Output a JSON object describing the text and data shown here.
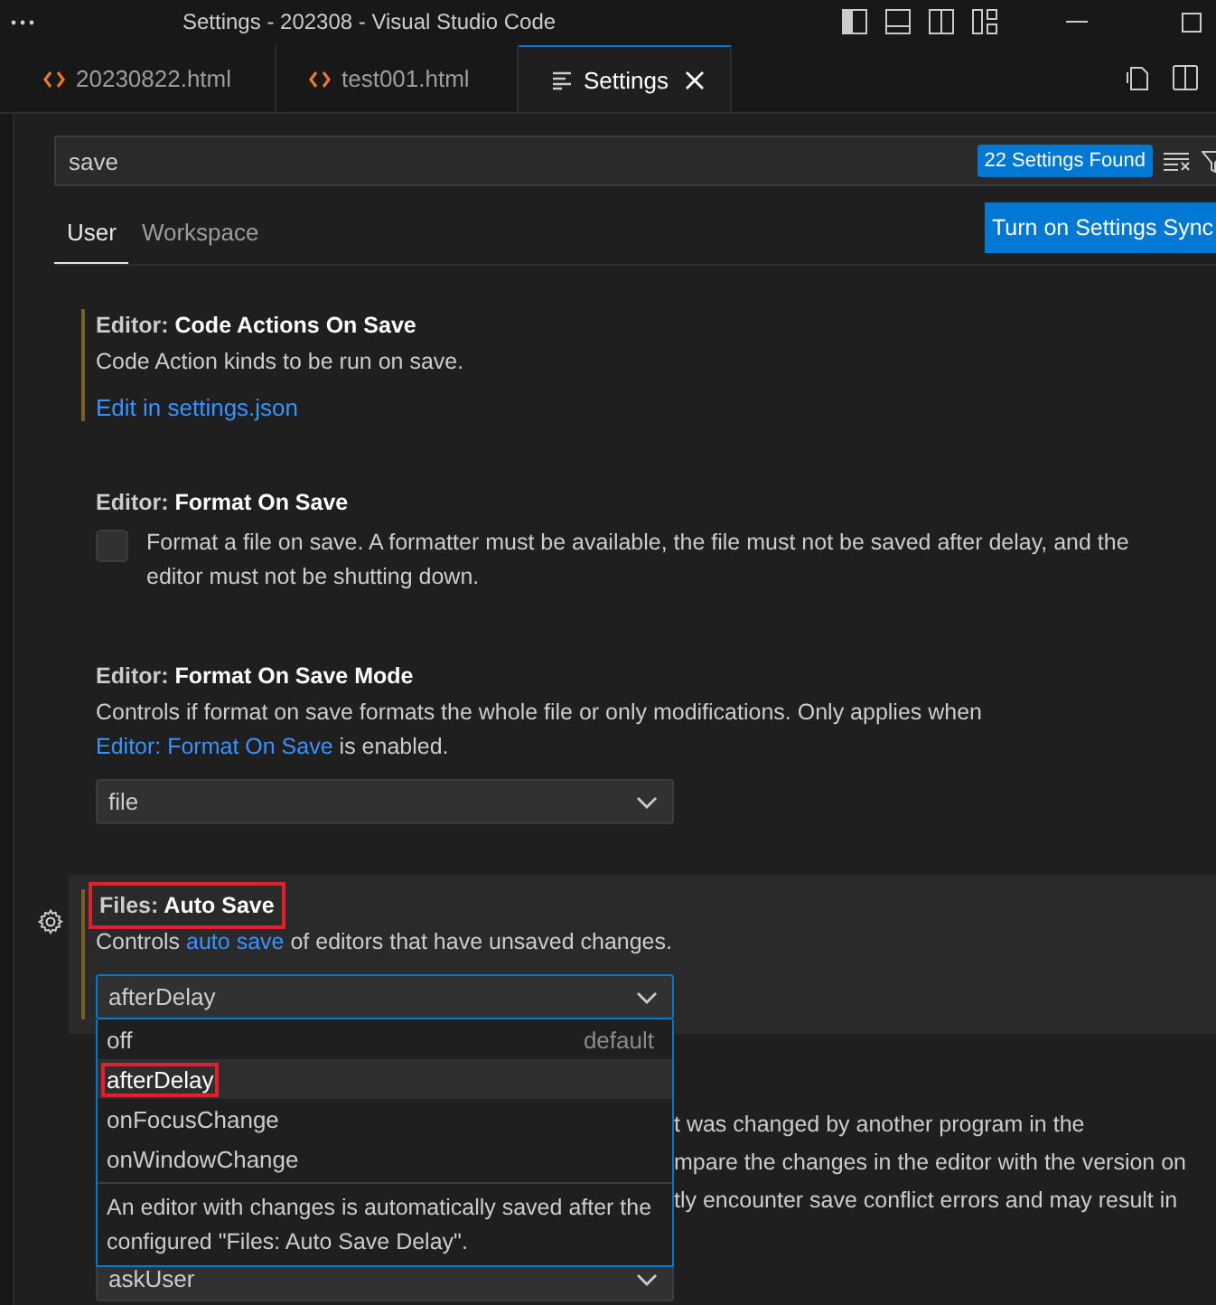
{
  "window": {
    "title": "Settings - 202308 - Visual Studio Code"
  },
  "tabs": [
    {
      "label": "20230822.html",
      "kind": "html",
      "selected": false
    },
    {
      "label": "test001.html",
      "kind": "html",
      "selected": false
    },
    {
      "label": "Settings",
      "kind": "settings",
      "selected": true
    }
  ],
  "search": {
    "value": "save",
    "result_count": "22 Settings Found"
  },
  "scope_tabs": [
    {
      "label": "User",
      "selected": true
    },
    {
      "label": "Workspace",
      "selected": false
    }
  ],
  "sync_button": "Turn on Settings Sync",
  "settings": [
    {
      "kind": "link",
      "category": "Editor:",
      "name": "Code Actions On Save",
      "modified": true,
      "annotated": false,
      "description": [
        {
          "text": "Code Action kinds to be run on save."
        }
      ],
      "link": "Edit in settings.json"
    },
    {
      "kind": "checkbox",
      "category": "Editor:",
      "name": "Format On Save",
      "modified": false,
      "annotated": false,
      "checked": false,
      "description": [
        {
          "text": "Format a file on save. A formatter must be available, the file must not be saved after delay, and the editor must not be shutting down."
        }
      ]
    },
    {
      "kind": "select",
      "category": "Editor:",
      "name": "Format On Save Mode",
      "modified": false,
      "annotated": false,
      "description": [
        {
          "text": "Controls if format on save formats the whole file or only modifications. Only applies when "
        },
        {
          "text": "Editor: Format On Save",
          "link": true
        },
        {
          "text": " is enabled."
        }
      ],
      "value": "file",
      "open": false
    },
    {
      "kind": "select",
      "category": "Files:",
      "name": "Auto Save",
      "modified": true,
      "focused": true,
      "annotated": true,
      "description": [
        {
          "text": "Controls "
        },
        {
          "text": "auto save",
          "link": true
        },
        {
          "text": " of editors that have unsaved changes."
        }
      ],
      "value": "afterDelay",
      "open": true,
      "options": [
        {
          "label": "off",
          "note": "default",
          "selected": false,
          "annotated": false
        },
        {
          "label": "afterDelay",
          "selected": true,
          "annotated": true
        },
        {
          "label": "onFocusChange",
          "selected": false,
          "annotated": false
        },
        {
          "label": "onWindowChange",
          "selected": false,
          "annotated": false
        }
      ],
      "option_help": "An editor with changes is automatically saved after the configured \"Files: Auto Save Delay\"."
    },
    {
      "kind": "covered",
      "fragments": [
        "t was changed by another program in the",
        "mpare the changes in the editor with the version on",
        "tly encounter save conflict errors and may result in"
      ],
      "value": "askUser"
    }
  ]
}
